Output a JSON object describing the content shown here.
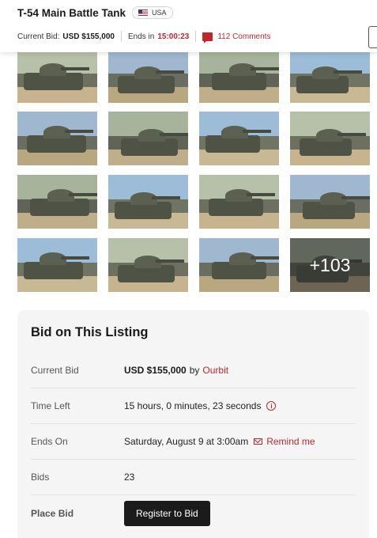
{
  "listing": {
    "title": "T-54 Main Battle Tank",
    "country_label": "USA",
    "flag_icon": "us-flag-icon"
  },
  "info_bar": {
    "current_bid_label": "Current Bid:",
    "current_bid_value": "USD $155,000",
    "ends_in_label": "Ends in",
    "ends_in_value": "15:00:23",
    "comments_label": "112 Comments"
  },
  "gallery": {
    "more_count": "+103",
    "photo_count_visible": 16
  },
  "bid_panel": {
    "heading": "Bid on This Listing",
    "current_bid_label": "Current Bid",
    "current_bid_amount": "USD $155,000",
    "current_bid_by": "by",
    "current_bid_user": "Ourbit",
    "time_left_label": "Time Left",
    "time_left_value": "15 hours, 0 minutes, 23 seconds",
    "ends_on_label": "Ends On",
    "ends_on_value": "Saturday, August 9 at 3:00am",
    "remind_label": "Remind me",
    "bids_label": "Bids",
    "bids_value": "23",
    "place_bid_label": "Place Bid",
    "register_button": "Register to Bid"
  },
  "colors": {
    "accent_red": "#c0272d",
    "button_dark": "#1b1b1b",
    "panel_bg": "#f5f5f5"
  }
}
